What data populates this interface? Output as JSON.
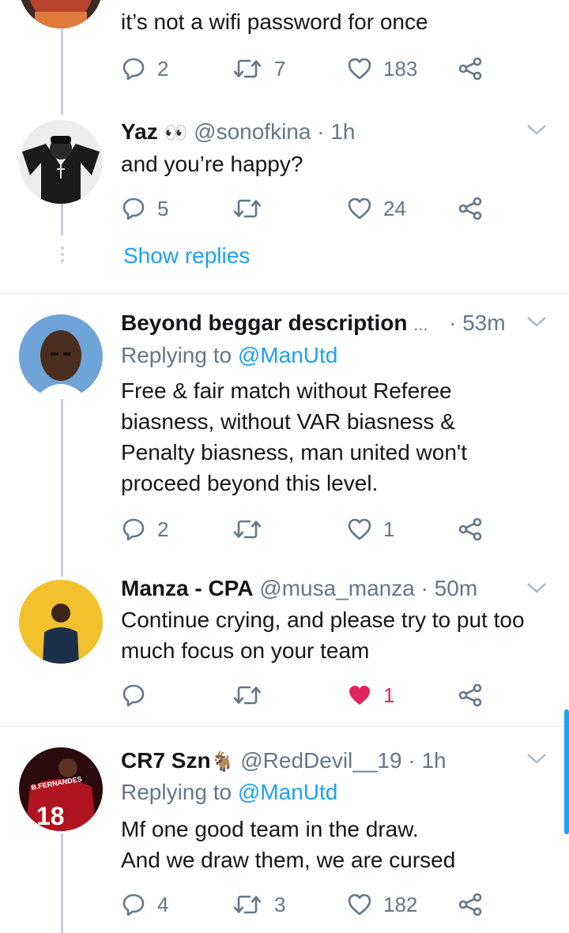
{
  "tweet_top": {
    "text": "it’s not a wifi password for once",
    "replies": "2",
    "retweets": "7",
    "likes": "183"
  },
  "tweet_yaz": {
    "name": "Yaz",
    "emoji": "👀",
    "handle": "@sonofkina",
    "time": "· 1h",
    "text": "and you’re happy?",
    "replies": "5",
    "likes": "24",
    "show_replies": "Show replies"
  },
  "tweet_beyond": {
    "name": "Beyond beggar description",
    "ellipsis": "...",
    "time": "· 53m",
    "replying_prefix": "Replying to",
    "replying_handle": "@ManUtd",
    "text_lines": [
      "Free & fair match without Referee",
      "biasness, without VAR biasness &",
      "Penalty biasness, man united won't",
      "proceed beyond this level."
    ],
    "replies": "2",
    "likes": "1"
  },
  "tweet_manza": {
    "name": "Manza - CPA",
    "handle": "@musa_manza",
    "time": "· 50m",
    "text_lines": [
      "Continue crying, and please try to put too",
      "much focus on your team"
    ],
    "likes": "1",
    "liked": true
  },
  "tweet_cr7": {
    "name": "CR7 Szn",
    "emoji": "🐐",
    "handle": "@RedDevil__19",
    "time": "· 1h",
    "replying_prefix": "Replying to",
    "replying_handle": "@ManUtd",
    "text_lines": [
      "Mf one good team in the draw.",
      "And we draw them, we are cursed"
    ],
    "replies": "4",
    "retweets": "3",
    "likes": "182",
    "jersey_name": "B.FERNANDES",
    "jersey_number": "18"
  },
  "colors": {
    "link_blue": "#1da1f2",
    "gray_text": "#657786",
    "like_red": "#e0245e",
    "thread_line": "#c4cfd6"
  }
}
